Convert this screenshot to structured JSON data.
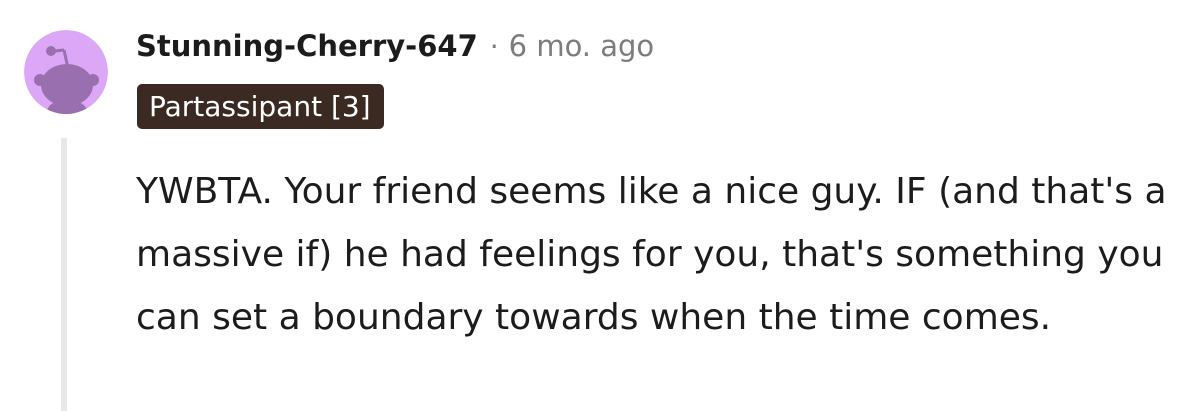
{
  "comment": {
    "author": "Stunning-Cherry-647",
    "separator": "·",
    "time_ago": "6 mo. ago",
    "flair": "Partassipant [3]",
    "body": "YWBTA. Your friend seems like a nice guy. IF (and that's a massive if) he had feelings for you, that's something you can set a boundary towards when the time comes."
  },
  "colors": {
    "avatar_background": "#dca7f6",
    "snoo_silhouette": "#9a6fb0",
    "flair_background": "#3a2a21",
    "flair_text": "#ffffff",
    "meta_text": "#7c7c7c",
    "thread_line": "#e8e8e8"
  },
  "icons": {
    "avatar": "snoo-avatar-icon"
  }
}
